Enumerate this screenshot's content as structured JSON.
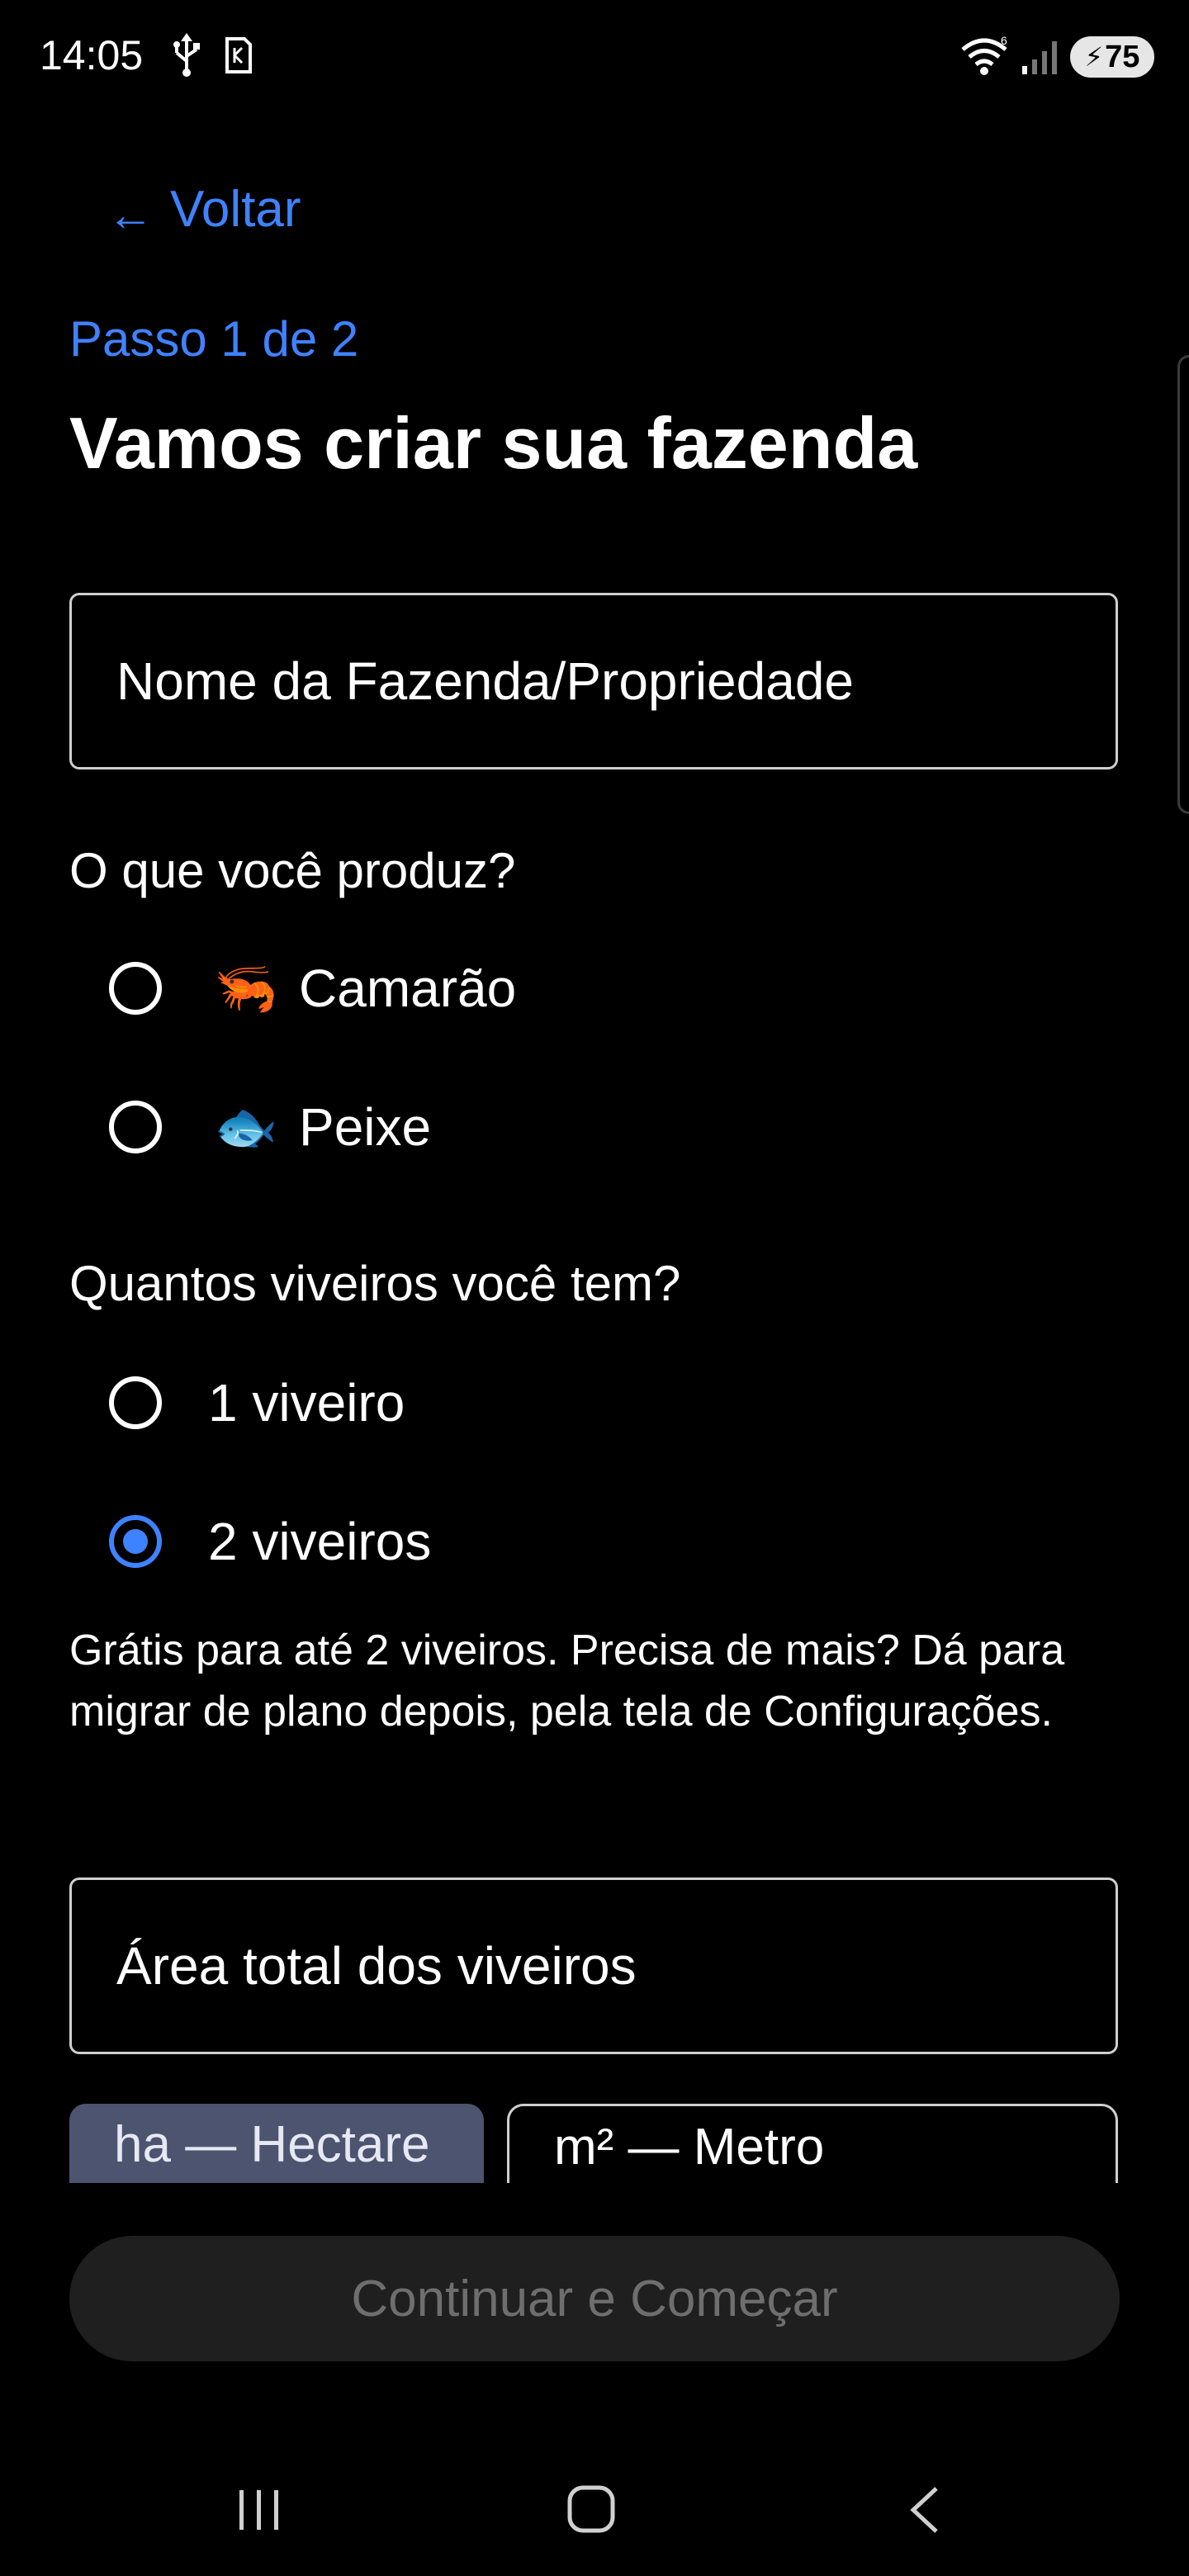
{
  "status_bar": {
    "time": "14:05",
    "battery_level": "75",
    "battery_bolt": "⚡",
    "wifi_label": "6",
    "icons": [
      "usb-icon",
      "sim-icon",
      "wifi-icon",
      "signal-icon",
      "battery-icon"
    ]
  },
  "header": {
    "back_arrow": "←",
    "back_label": "Voltar",
    "step_label": "Passo 1 de 2",
    "title": "Vamos criar sua fazenda"
  },
  "form": {
    "farm_name_placeholder": "Nome da Fazenda/Propriedade",
    "produce_question": "O que você produz?",
    "produce_options": [
      {
        "emoji": "🦐",
        "label": "Camarão",
        "selected": false
      },
      {
        "emoji": "🐟",
        "label": "Peixe",
        "selected": false
      }
    ],
    "ponds_question": "Quantos viveiros você tem?",
    "pond_options": [
      {
        "label": "1 viveiro",
        "selected": false
      },
      {
        "label": "2 viveiros",
        "selected": true
      }
    ],
    "pond_helper": "Grátis para até 2 viveiros. Precisa de mais? Dá para migrar de plano depois, pela tela de Configurações.",
    "area_placeholder": "Área total dos viveiros",
    "area_units": [
      {
        "label": "ha — Hectare",
        "selected": true
      },
      {
        "label": "m² — Metro",
        "selected": false
      }
    ]
  },
  "actions": {
    "continue_label": "Continuar e Começar",
    "continue_enabled": false
  },
  "colors": {
    "accent": "#3f82ff",
    "background": "#000000",
    "selected_unit_bg": "#4c5470",
    "disabled_button_bg": "#1f1f1f",
    "disabled_button_text": "#6e6e6e"
  }
}
